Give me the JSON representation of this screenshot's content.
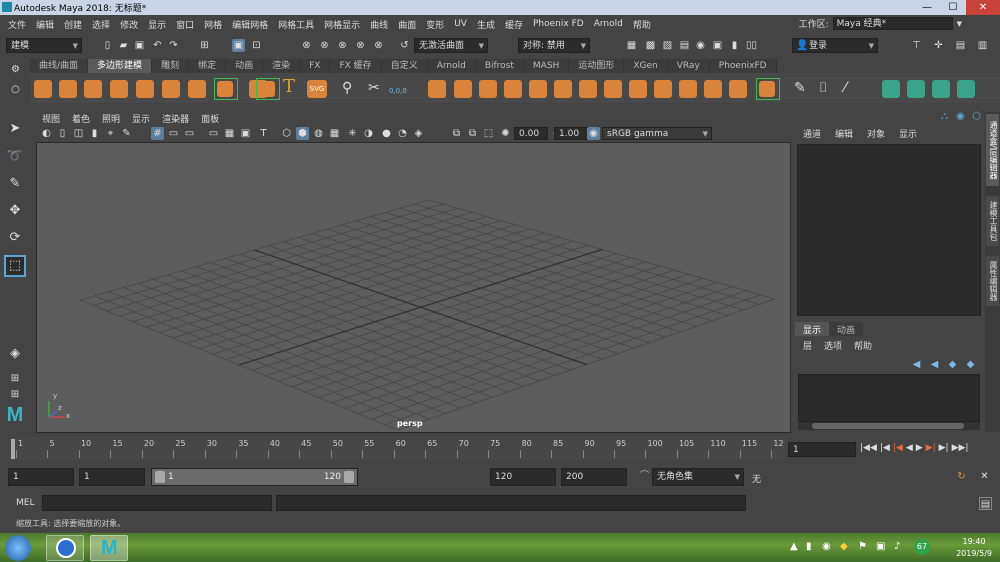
{
  "window": {
    "title": "Autodesk Maya 2018: 无标题*",
    "buttons": [
      "—",
      "☐",
      "✕"
    ]
  },
  "menu": [
    "文件",
    "编辑",
    "创建",
    "选择",
    "修改",
    "显示",
    "窗口",
    "网格",
    "编辑网格",
    "网格工具",
    "网格显示",
    "曲线",
    "曲面",
    "变形",
    "UV",
    "生成",
    "缓存",
    "Phoenix FD",
    "Arnold",
    "帮助"
  ],
  "workspace": {
    "label": "工作区:",
    "value": "Maya 经典*"
  },
  "statusline": {
    "mode": "建模",
    "live_surface": "无激活曲面",
    "symmetry": "对称: 禁用",
    "login": "登录"
  },
  "shelf": {
    "tabs": [
      "曲线/曲面",
      "多边形建模",
      "雕刻",
      "绑定",
      "动画",
      "渲染",
      "FX",
      "FX 缓存",
      "自定义",
      "Arnold",
      "Bifrost",
      "MASH",
      "运动图形",
      "XGen",
      "VRay",
      "PhoenixFD"
    ],
    "active_tab": "多边形建模",
    "text_icons": {
      "text_tool": "T",
      "svg_tool": "SVG",
      "coords": "0,0,0"
    }
  },
  "viewport": {
    "menu": [
      "视图",
      "着色",
      "照明",
      "显示",
      "渲染器",
      "面板"
    ],
    "exposure": "0.00",
    "gamma": "1.00",
    "color_space": "sRGB gamma",
    "camera_label": "persp",
    "axis_labels": {
      "y": "y",
      "x": "x",
      "z": "z"
    }
  },
  "channel_box": {
    "tabs": [
      "通道",
      "编辑",
      "对象",
      "显示"
    ]
  },
  "layer_editor": {
    "tabs": [
      "显示",
      "动画"
    ],
    "menu": [
      "层",
      "选项",
      "帮助"
    ]
  },
  "side_tabs": [
    "通道盒/层编辑器",
    "建模工具包",
    "属性编辑器"
  ],
  "timeline": {
    "ticks": [
      "1",
      "5",
      "10",
      "15",
      "20",
      "25",
      "30",
      "35",
      "40",
      "45",
      "50",
      "55",
      "60",
      "65",
      "70",
      "75",
      "80",
      "85",
      "90",
      "95",
      "100",
      "105",
      "110",
      "115",
      "12"
    ],
    "current_frame": "1"
  },
  "range": {
    "start": "1",
    "playback_start": "1",
    "slider_start": "1",
    "slider_end": "120",
    "playback_end": "120",
    "end": "200",
    "char_set": "无角色集",
    "anim_layer": "无"
  },
  "command": {
    "label": "MEL"
  },
  "help_line": "缩放工具: 选择要缩放的对象。",
  "taskbar": {
    "time": "19:40",
    "date": "2019/5/9",
    "badge": "67"
  }
}
